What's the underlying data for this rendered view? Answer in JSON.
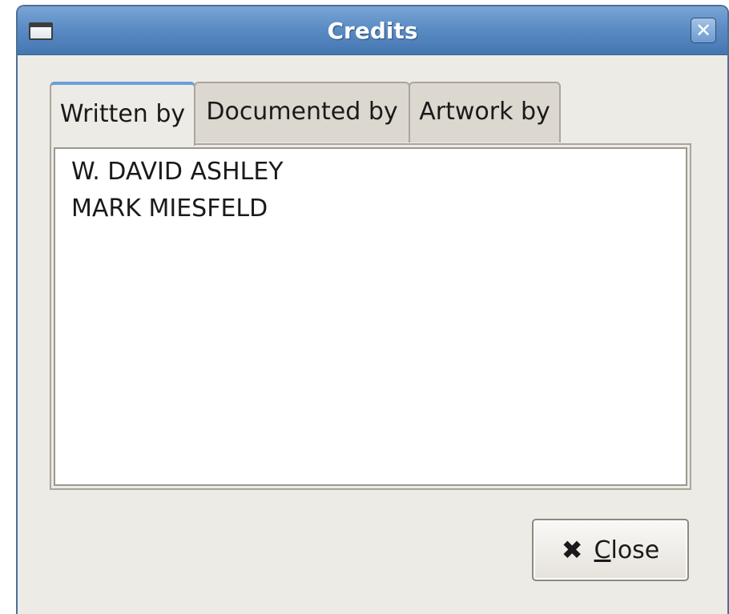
{
  "window": {
    "title": "Credits",
    "close_glyph": "✕"
  },
  "tabs": [
    {
      "label": "Written by",
      "active": true
    },
    {
      "label": "Documented by",
      "active": false
    },
    {
      "label": "Artwork by",
      "active": false
    }
  ],
  "credits": {
    "written_by": [
      "W. DAVID ASHLEY",
      "MARK MIESFELD"
    ]
  },
  "close_button": {
    "icon": "close-icon",
    "mnemonic": "C",
    "rest": "lose"
  },
  "colors": {
    "titlebar": "#5b8cc4",
    "active_tab_accent": "#6c9ed8",
    "window_bg": "#edebe6"
  }
}
